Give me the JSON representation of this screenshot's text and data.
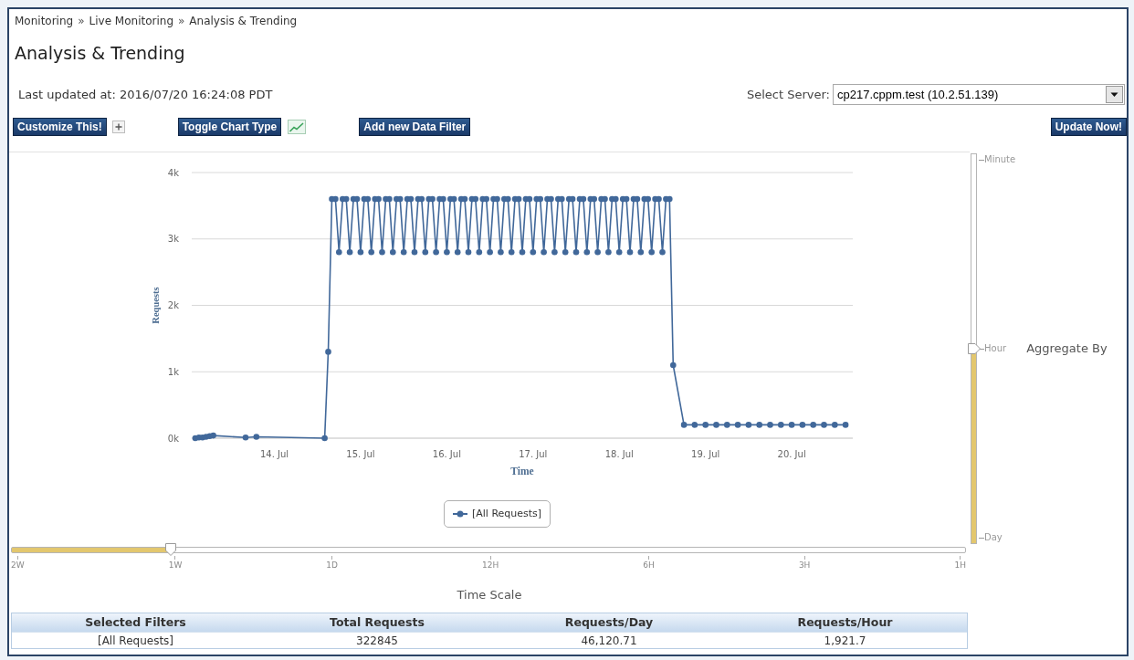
{
  "breadcrumb": [
    {
      "kind": "link",
      "text": "Monitoring"
    },
    {
      "kind": "separator",
      "text": "»"
    },
    {
      "kind": "link",
      "text": "Live Monitoring"
    },
    {
      "kind": "separator",
      "text": "»"
    },
    {
      "kind": "current",
      "text": "Analysis & Trending"
    }
  ],
  "page_title": "Analysis & Trending",
  "last_updated": "Last updated at: 2016/07/20 16:24:08 PDT",
  "server_select": {
    "label": "Select Server:",
    "value": "cp217.cppm.test (10.2.51.139)"
  },
  "toolbar": [
    "Customize This!",
    "Toggle Chart Type",
    "Add new Data Filter"
  ],
  "update_button": "Update Now!",
  "chart": {
    "chart_data": {
      "type": "line",
      "xlabel": "Time",
      "ylabel": "Requests",
      "grid": true,
      "marker": "circle",
      "legend": "bottom",
      "xlim": [
        "2016-07-13T01:00",
        "2016-07-20T17:00"
      ],
      "ylim": [
        0,
        4000
      ],
      "xticks": [
        {
          "value": "2016-07-14",
          "label": "14. Jul"
        },
        {
          "value": "2016-07-15",
          "label": "15. Jul"
        },
        {
          "value": "2016-07-16",
          "label": "16. Jul"
        },
        {
          "value": "2016-07-17",
          "label": "17. Jul"
        },
        {
          "value": "2016-07-18",
          "label": "18. Jul"
        },
        {
          "value": "2016-07-19",
          "label": "19. Jul"
        },
        {
          "value": "2016-07-20",
          "label": "20. Jul"
        }
      ],
      "yticks": [
        {
          "value": 0,
          "label": "0k"
        },
        {
          "value": 1000,
          "label": "1k"
        },
        {
          "value": 2000,
          "label": "2k"
        },
        {
          "value": 3000,
          "label": "3k"
        },
        {
          "value": 4000,
          "label": "4k"
        }
      ],
      "x": [
        "2016-07-13T02:00",
        "2016-07-13T03:00",
        "2016-07-13T04:00",
        "2016-07-13T05:00",
        "2016-07-13T06:00",
        "2016-07-13T07:00",
        "2016-07-13T16:00",
        "2016-07-13T19:00",
        "2016-07-14T14:00",
        "2016-07-14T15:00",
        "2016-07-14T16:00",
        "2016-07-14T17:00",
        "2016-07-14T18:00",
        "2016-07-14T19:00",
        "2016-07-14T20:00",
        "2016-07-14T21:00",
        "2016-07-14T22:00",
        "2016-07-14T23:00",
        "2016-07-15T00:00",
        "2016-07-15T01:00",
        "2016-07-15T02:00",
        "2016-07-15T03:00",
        "2016-07-15T04:00",
        "2016-07-15T05:00",
        "2016-07-15T06:00",
        "2016-07-15T07:00",
        "2016-07-15T08:00",
        "2016-07-15T09:00",
        "2016-07-15T10:00",
        "2016-07-15T11:00",
        "2016-07-15T12:00",
        "2016-07-15T13:00",
        "2016-07-15T14:00",
        "2016-07-15T15:00",
        "2016-07-15T16:00",
        "2016-07-15T17:00",
        "2016-07-15T18:00",
        "2016-07-15T19:00",
        "2016-07-15T20:00",
        "2016-07-15T21:00",
        "2016-07-15T22:00",
        "2016-07-15T23:00",
        "2016-07-16T00:00",
        "2016-07-16T01:00",
        "2016-07-16T02:00",
        "2016-07-16T03:00",
        "2016-07-16T04:00",
        "2016-07-16T05:00",
        "2016-07-16T06:00",
        "2016-07-16T07:00",
        "2016-07-16T08:00",
        "2016-07-16T09:00",
        "2016-07-16T10:00",
        "2016-07-16T11:00",
        "2016-07-16T12:00",
        "2016-07-16T13:00",
        "2016-07-16T14:00",
        "2016-07-16T15:00",
        "2016-07-16T16:00",
        "2016-07-16T17:00",
        "2016-07-16T18:00",
        "2016-07-16T19:00",
        "2016-07-16T20:00",
        "2016-07-16T21:00",
        "2016-07-16T22:00",
        "2016-07-16T23:00",
        "2016-07-17T00:00",
        "2016-07-17T01:00",
        "2016-07-17T02:00",
        "2016-07-17T03:00",
        "2016-07-17T04:00",
        "2016-07-17T05:00",
        "2016-07-17T06:00",
        "2016-07-17T07:00",
        "2016-07-17T08:00",
        "2016-07-17T09:00",
        "2016-07-17T10:00",
        "2016-07-17T11:00",
        "2016-07-17T12:00",
        "2016-07-17T13:00",
        "2016-07-17T14:00",
        "2016-07-17T15:00",
        "2016-07-17T16:00",
        "2016-07-17T17:00",
        "2016-07-17T18:00",
        "2016-07-17T19:00",
        "2016-07-17T20:00",
        "2016-07-17T21:00",
        "2016-07-17T22:00",
        "2016-07-17T23:00",
        "2016-07-18T00:00",
        "2016-07-18T01:00",
        "2016-07-18T02:00",
        "2016-07-18T03:00",
        "2016-07-18T04:00",
        "2016-07-18T05:00",
        "2016-07-18T06:00",
        "2016-07-18T07:00",
        "2016-07-18T08:00",
        "2016-07-18T09:00",
        "2016-07-18T10:00",
        "2016-07-18T11:00",
        "2016-07-18T12:00",
        "2016-07-18T13:00",
        "2016-07-18T14:00",
        "2016-07-18T15:00",
        "2016-07-18T18:00",
        "2016-07-18T21:00",
        "2016-07-19T00:00",
        "2016-07-19T03:00",
        "2016-07-19T06:00",
        "2016-07-19T09:00",
        "2016-07-19T12:00",
        "2016-07-19T15:00",
        "2016-07-19T18:00",
        "2016-07-19T21:00",
        "2016-07-20T00:00",
        "2016-07-20T03:00",
        "2016-07-20T06:00",
        "2016-07-20T09:00",
        "2016-07-20T12:00",
        "2016-07-20T15:00"
      ],
      "series": [
        {
          "name": "[All Requests]",
          "color": "#41689a",
          "values": [
            0,
            10,
            10,
            20,
            30,
            40,
            10,
            20,
            0,
            1300,
            3600,
            3600,
            2800,
            3600,
            3600,
            2800,
            3600,
            3600,
            2800,
            3600,
            3600,
            2800,
            3600,
            3600,
            2800,
            3600,
            3600,
            2800,
            3600,
            3600,
            2800,
            3600,
            3600,
            2800,
            3600,
            3600,
            2800,
            3600,
            3600,
            2800,
            3600,
            3600,
            2800,
            3600,
            3600,
            2800,
            3600,
            3600,
            2800,
            3600,
            3600,
            2800,
            3600,
            3600,
            2800,
            3600,
            3600,
            2800,
            3600,
            3600,
            2800,
            3600,
            3600,
            2800,
            3600,
            3600,
            2800,
            3600,
            3600,
            2800,
            3600,
            3600,
            2800,
            3600,
            3600,
            2800,
            3600,
            3600,
            2800,
            3600,
            3600,
            2800,
            3600,
            3600,
            2800,
            3600,
            3600,
            2800,
            3600,
            3600,
            2800,
            3600,
            3600,
            2800,
            3600,
            3600,
            2800,
            3600,
            3600,
            2800,
            3600,
            3600,
            2800,
            3600,
            3600,
            1100,
            200,
            200,
            200,
            200,
            200,
            200,
            200,
            200,
            200,
            200,
            200,
            200,
            200,
            200,
            200,
            200
          ]
        }
      ]
    }
  },
  "aggregate_slider": {
    "label": "Aggregate By",
    "level": 0.5,
    "ticks": [
      "Minute",
      "Hour",
      "Day"
    ]
  },
  "time_scale_slider": {
    "label": "Time Scale",
    "level": 0.1667,
    "ticks": [
      "2W",
      "1W",
      "1D",
      "12H",
      "6H",
      "3H",
      "1H"
    ]
  },
  "summary_table": {
    "columns": [
      "Selected Filters",
      "Total Requests",
      "Requests/Day",
      "Requests/Hour"
    ],
    "rows": [
      [
        "[All Requests]",
        "322845",
        "46,120.71",
        "1,921.7"
      ]
    ]
  }
}
